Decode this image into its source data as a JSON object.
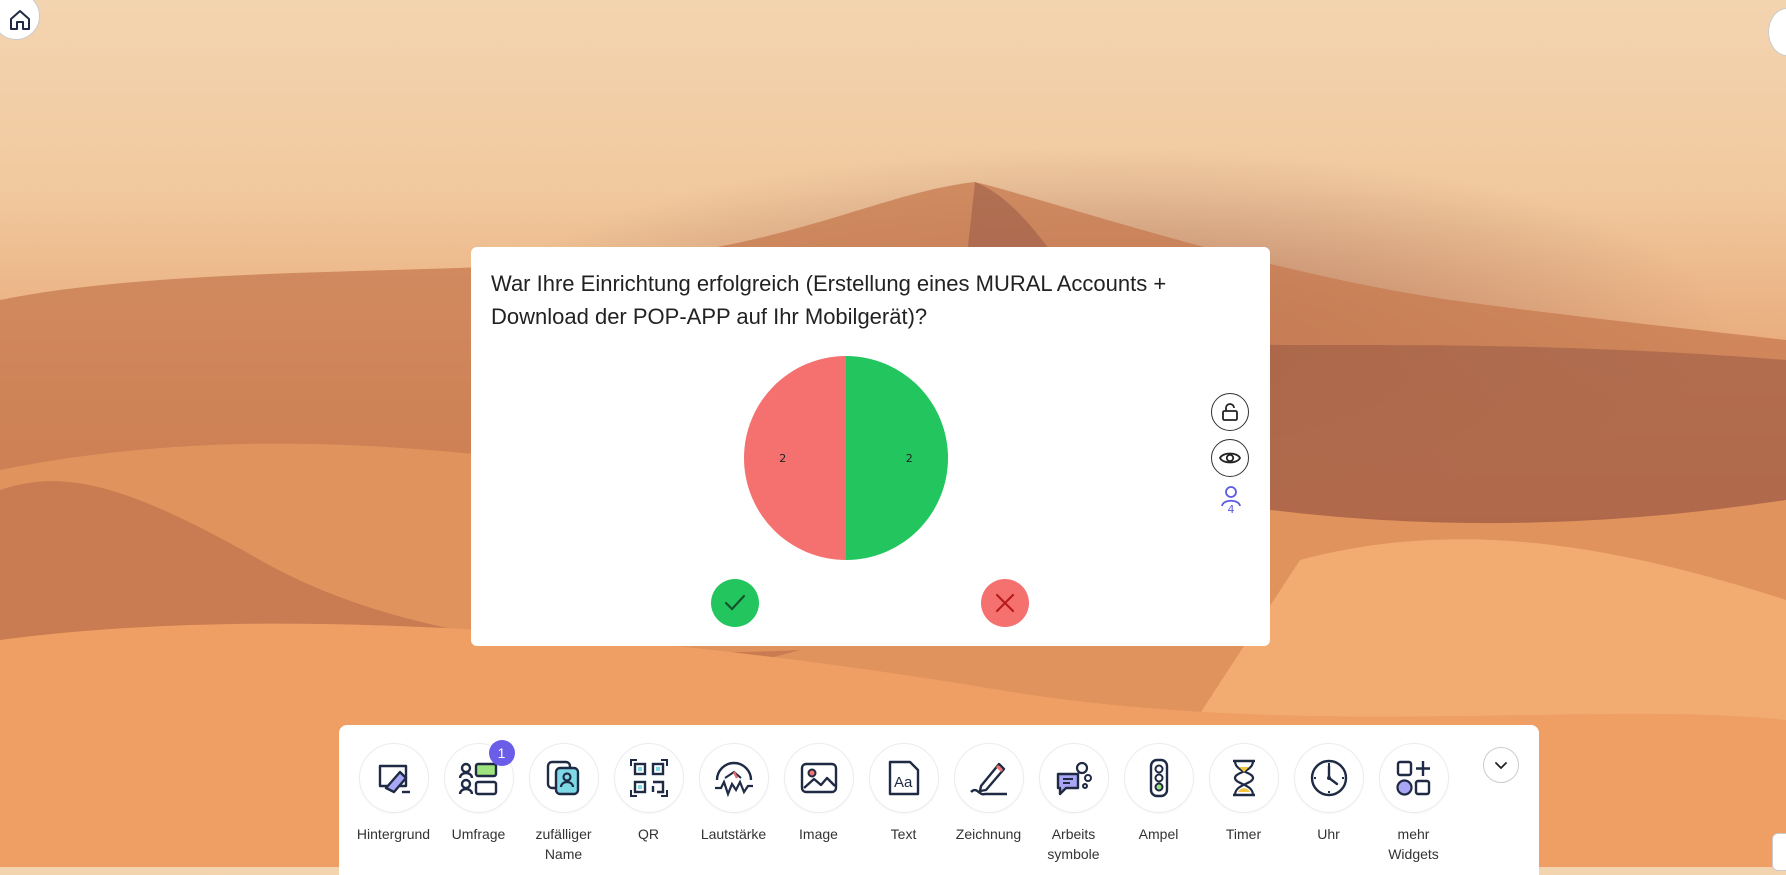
{
  "poll": {
    "question": "War Ihre Einrichtung erfolgreich (Erstellung eines MURAL Accounts + Download der POP-APP auf Ihr Mobilgerät)?",
    "participant_count": "4"
  },
  "chart_data": {
    "type": "pie",
    "series": [
      {
        "label": "Nein",
        "value": 2,
        "color": "#f4716f"
      },
      {
        "label": "Ja",
        "value": 2,
        "color": "#22c55e"
      }
    ]
  },
  "vote": {
    "yes_color": "#22c55e",
    "no_color": "#f4716f"
  },
  "toolbar": {
    "items": [
      {
        "label": "Hintergrund",
        "icon": "background-icon"
      },
      {
        "label": "Umfrage",
        "icon": "poll-icon",
        "badge": "1"
      },
      {
        "label": "zufälliger Name",
        "icon": "random-name-icon"
      },
      {
        "label": "QR",
        "icon": "qr-icon"
      },
      {
        "label": "Lautstärke",
        "icon": "volume-meter-icon"
      },
      {
        "label": "Image",
        "icon": "image-icon"
      },
      {
        "label": "Text",
        "icon": "text-icon"
      },
      {
        "label": "Zeichnung",
        "icon": "drawing-icon"
      },
      {
        "label": "Arbeits symbole",
        "icon": "work-symbols-icon"
      },
      {
        "label": "Ampel",
        "icon": "traffic-light-icon"
      },
      {
        "label": "Timer",
        "icon": "hourglass-icon"
      },
      {
        "label": "Uhr",
        "icon": "clock-icon"
      },
      {
        "label": "mehr Widgets",
        "icon": "more-widgets-icon"
      }
    ]
  }
}
